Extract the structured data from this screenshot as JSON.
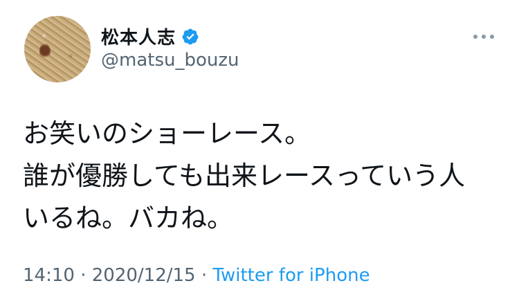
{
  "author": {
    "display_name": "松本人志",
    "handle": "@matsu_bouzu",
    "verified_icon": "verified-badge",
    "verified_color": "#1d9bf0"
  },
  "tweet": {
    "lines": [
      "お笑いのショーレース。",
      "誰が優勝しても出来レースっていう人",
      "いるね。バカね。"
    ]
  },
  "meta": {
    "time": "14:10",
    "separator1": " · ",
    "date": "2020/12/15",
    "separator2": " · ",
    "source": "Twitter for iPhone"
  },
  "colors": {
    "link": "#1d9bf0",
    "secondary_text": "#536471",
    "primary_text": "#0f1419"
  },
  "icons": {
    "more": "more-horizontal-icon"
  }
}
